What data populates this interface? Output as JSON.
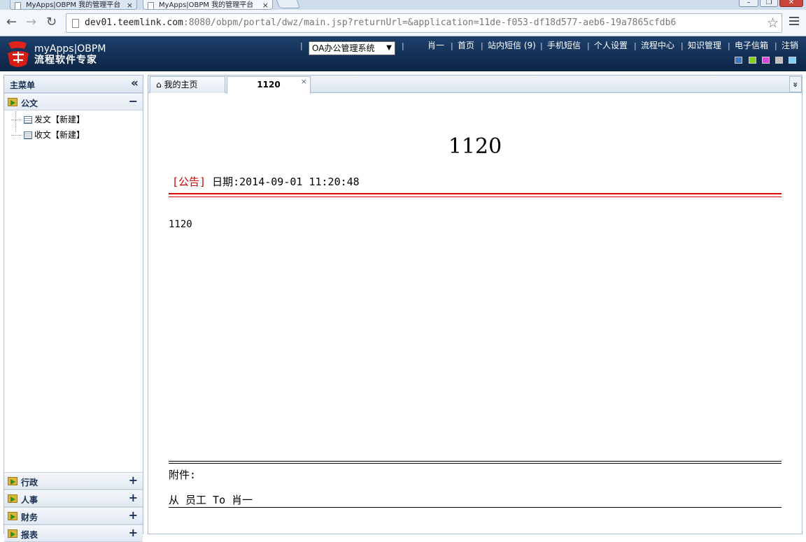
{
  "browser": {
    "tabs": [
      {
        "title": "MyApps|OBPM 我的管理平台"
      },
      {
        "title": "MyApps|OBPM 我的管理平台"
      }
    ],
    "close_glyph": "×",
    "window_controls": [
      "–",
      "❐",
      "✕"
    ],
    "nav": {
      "back": "←",
      "forward": "→",
      "reload": "↻"
    },
    "url_host": "dev01.teemlink.com",
    "url_rest": ":8080/obpm/portal/dwz/main.jsp?returnUrl=&application=11de-f053-df18d577-aeb6-19a7865cfdb6",
    "star": "☆"
  },
  "header": {
    "logo_title": "myApps|OBPM",
    "logo_subtitle": "流程软件专家",
    "system_select": "OA办公管理系统",
    "select_arrow": "▼",
    "separator": "|",
    "links": [
      "肖一",
      "首页",
      "站内短信 (9)",
      "手机短信",
      "个人设置",
      "流程中心",
      "知识管理",
      "电子信箱",
      "注销"
    ],
    "theme_colors": [
      "#3a78c8",
      "#7fd31a",
      "#d54bd8",
      "#c0c0c0",
      "#7ecff4"
    ]
  },
  "sidebar": {
    "title": "主菜单",
    "collapse_glyph": "«",
    "open_group": "公文",
    "open_toggle": "−",
    "items": [
      "发文【新建】",
      "收文【新建】"
    ],
    "closed_groups": [
      "行政",
      "人事",
      "财务",
      "报表"
    ],
    "closed_toggle": "+"
  },
  "tabs": {
    "home": "我的主页",
    "home_glyph": "⌂",
    "active": "1120",
    "more_glyph": "»"
  },
  "doc": {
    "title": "1120",
    "tag": "[公告]",
    "date_label": "日期:",
    "date_value": "2014-09-01 11:20:48",
    "body": "1120",
    "attachment_label": "附件:",
    "from_line": "从 员工 To 肖一"
  }
}
